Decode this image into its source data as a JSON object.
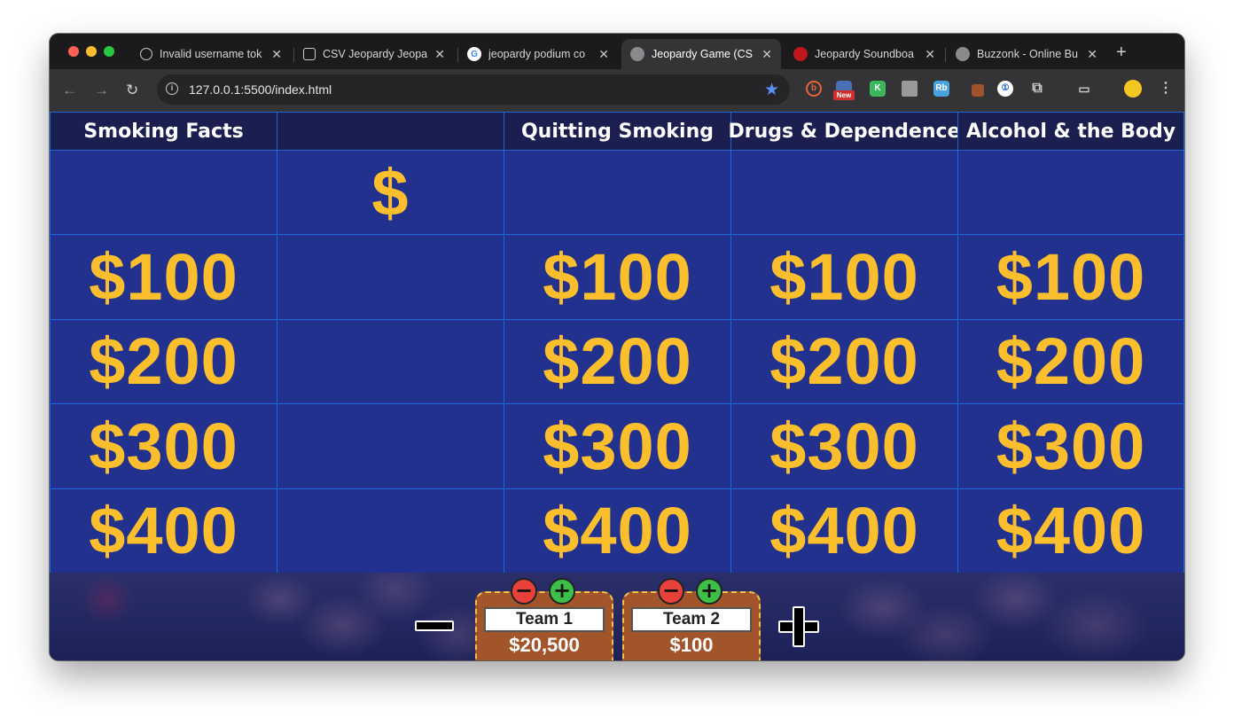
{
  "browser": {
    "tabs": [
      {
        "title": "Invalid username tok",
        "icon": "openai-icon"
      },
      {
        "title": "CSV Jeopardy Jeopa",
        "icon": "openai-icon"
      },
      {
        "title": "jeopardy podium co",
        "icon": "google-icon"
      },
      {
        "title": "Jeopardy Game (CS",
        "icon": "globe-icon",
        "active": true
      },
      {
        "title": "Jeopardy Soundboa",
        "icon": "soundboard-icon"
      },
      {
        "title": "Buzzonk - Online Bu",
        "icon": "globe-icon"
      }
    ],
    "url": "127.0.0.1:5500/index.html",
    "extension_badge": "New",
    "extension_letter_k": "K",
    "extension_rb": "Rb"
  },
  "board": {
    "categories": [
      "Smoking Facts",
      "",
      "Quitting Smoking",
      "Drugs & Dependence",
      "Alcohol & the Body"
    ],
    "special_cell": "$",
    "rows": [
      [
        "",
        "$",
        "",
        "",
        ""
      ],
      [
        "$100",
        "",
        "$100",
        "$100",
        "$100"
      ],
      [
        "$200",
        "",
        "$200",
        "$200",
        "$200"
      ],
      [
        "$300",
        "",
        "$300",
        "$300",
        "$300"
      ],
      [
        "$400",
        "",
        "$400",
        "$400",
        "$400"
      ]
    ]
  },
  "teams": [
    {
      "name": "Team 1",
      "score": "$20,500"
    },
    {
      "name": "Team 2",
      "score": "$100"
    }
  ],
  "colors": {
    "board_cell": "#23318e",
    "board_header": "#1a1f50",
    "board_border": "#1f67d8",
    "value_text": "#fbbf2e",
    "podium": "#a2552b"
  }
}
